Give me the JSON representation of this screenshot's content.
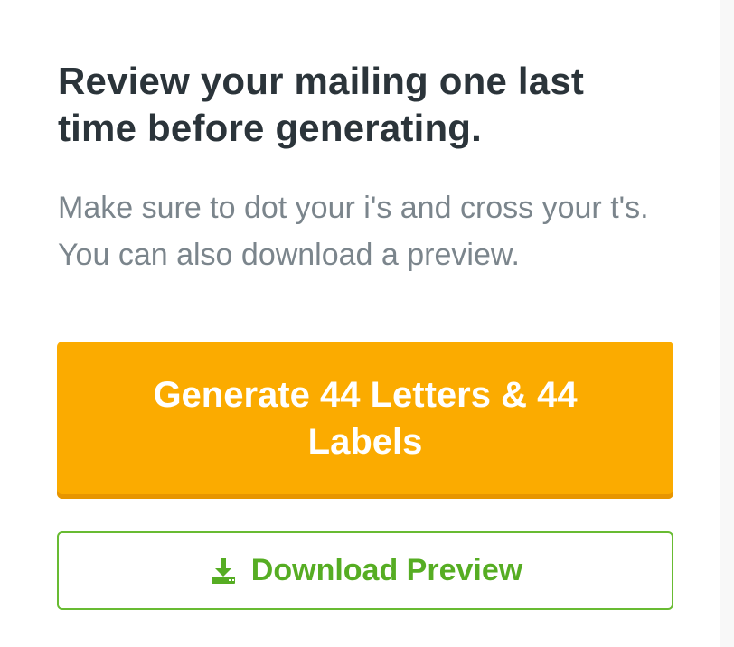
{
  "review": {
    "title": "Review your mailing one last time before generating.",
    "subtitle": "Make sure to dot your i's and cross your t's. You can also download a preview."
  },
  "actions": {
    "generate_label": "Generate 44 Letters & 44 Labels",
    "download_label": "Download Preview",
    "download_icon": "download-icon"
  },
  "colors": {
    "title": "#2b343a",
    "subtitle": "#7b858c",
    "primary": "#fbab00",
    "success": "#56ad23"
  }
}
